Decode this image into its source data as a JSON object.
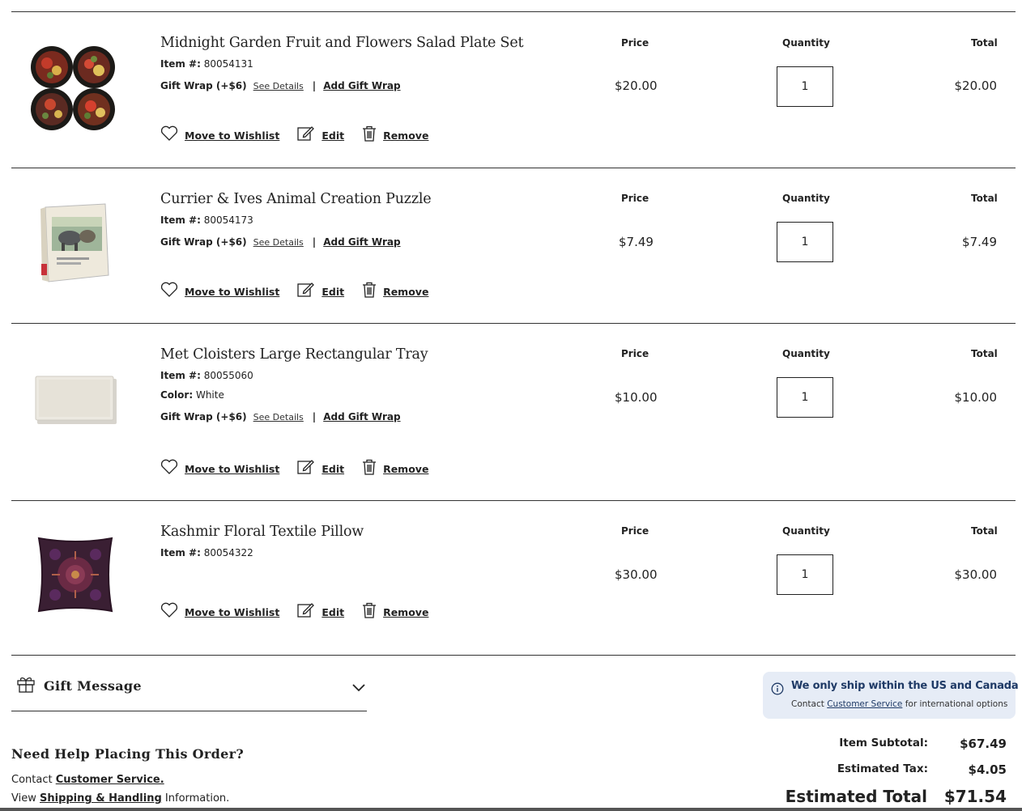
{
  "columns": {
    "price": "Price",
    "quantity": "Quantity",
    "total": "Total"
  },
  "labels": {
    "item_no": "Item #:",
    "color": "Color:",
    "gift_wrap": "Gift Wrap (+$6)",
    "see_details": "See Details",
    "separator": "|",
    "add_gift_wrap": "Add Gift Wrap",
    "move_to_wishlist": "Move to Wishlist",
    "edit": "Edit",
    "remove": "Remove"
  },
  "items": [
    {
      "title": "Midnight Garden Fruit and Flowers Salad Plate Set",
      "item_no": "80054131",
      "price": "$20.00",
      "quantity": "1",
      "total": "$20.00"
    },
    {
      "title": "Currier & Ives Animal Creation Puzzle",
      "item_no": "80054173",
      "price": "$7.49",
      "quantity": "1",
      "total": "$7.49"
    },
    {
      "title": "Met Cloisters Large Rectangular Tray",
      "item_no": "80055060",
      "color": "White",
      "price": "$10.00",
      "quantity": "1",
      "total": "$10.00"
    },
    {
      "title": "Kashmir Floral Textile Pillow",
      "item_no": "80054322",
      "price": "$30.00",
      "quantity": "1",
      "total": "$30.00"
    }
  ],
  "gift_message": {
    "title": "Gift Message"
  },
  "help": {
    "title": "Need Help Placing This Order?",
    "contact_prefix": "Contact",
    "contact_link": "Customer Service.",
    "view_prefix": "View",
    "shipping_link": "Shipping & Handling",
    "view_suffix": "Information."
  },
  "shipping_notice": {
    "title": "We only ship within the US and Canada",
    "prefix": "Contact",
    "link": "Customer Service",
    "suffix": "for international options"
  },
  "summary": {
    "subtotal_label": "Item Subtotal:",
    "subtotal": "$67.49",
    "tax_label": "Estimated Tax:",
    "tax": "$4.05",
    "total_label": "Estimated Total",
    "total": "$71.54"
  },
  "colors": {
    "notice_bg": "#e6ecf6",
    "notice_text": "#1f3a66",
    "rule": "#333333"
  }
}
